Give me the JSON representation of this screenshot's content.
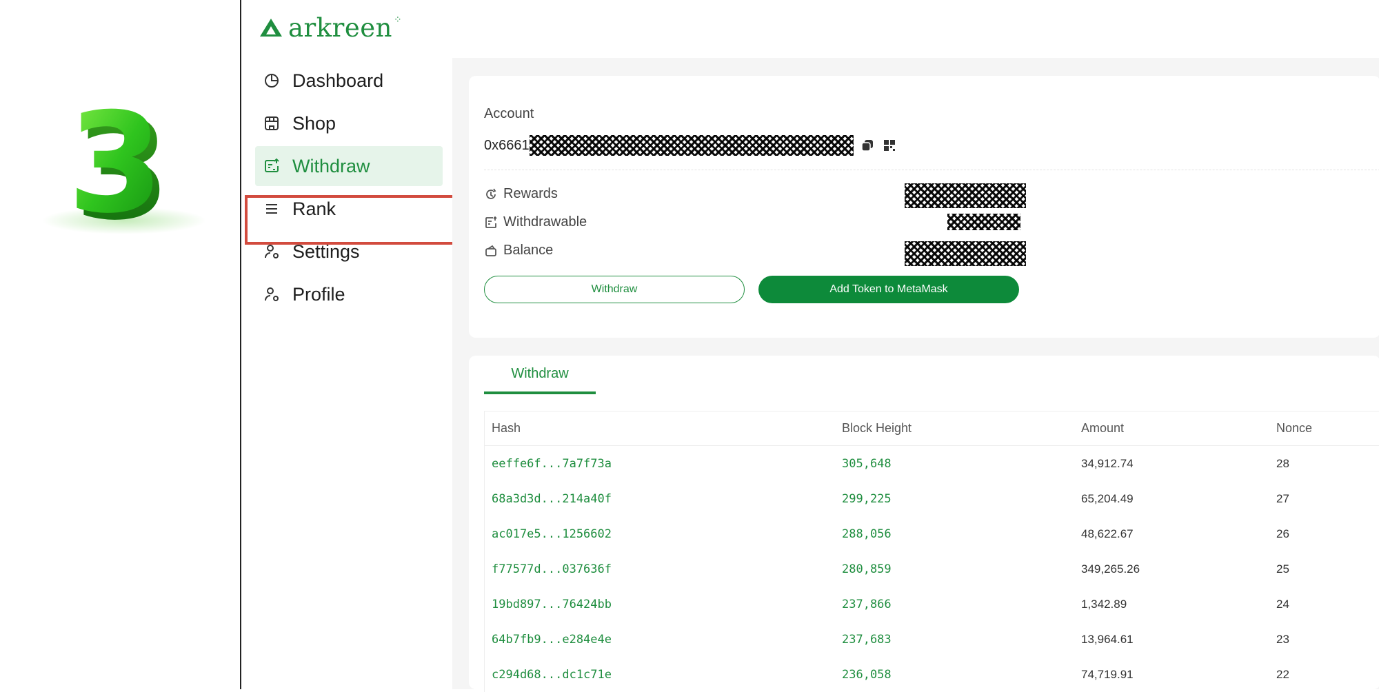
{
  "step_badge": {
    "number": "3"
  },
  "brand": {
    "name": "arkreen"
  },
  "sidebar": {
    "items": [
      {
        "label": "Dashboard",
        "icon": "pie-chart-icon"
      },
      {
        "label": "Shop",
        "icon": "store-icon"
      },
      {
        "label": "Withdraw",
        "icon": "withdraw-icon",
        "active": true
      },
      {
        "label": "Rank",
        "icon": "menu-lines-icon"
      },
      {
        "label": "Settings",
        "icon": "user-gear-icon"
      },
      {
        "label": "Profile",
        "icon": "user-gear-icon"
      }
    ]
  },
  "account": {
    "title": "Account",
    "address_prefix": "0x6661",
    "stats": [
      {
        "label": "Rewards",
        "icon": "rewards-icon"
      },
      {
        "label": "Withdrawable",
        "icon": "withdraw-icon"
      },
      {
        "label": "Balance",
        "icon": "wallet-icon"
      }
    ],
    "withdraw_button": "Withdraw",
    "metamask_button": "Add Token to MetaMask"
  },
  "history": {
    "tab": "Withdraw",
    "columns": [
      "Hash",
      "Block Height",
      "Amount",
      "Nonce"
    ],
    "rows": [
      {
        "hash": "eeffe6f...7a7f73a",
        "block": "305,648",
        "amount": "34,912.74",
        "nonce": "28"
      },
      {
        "hash": "68a3d3d...214a40f",
        "block": "299,225",
        "amount": "65,204.49",
        "nonce": "27"
      },
      {
        "hash": "ac017e5...1256602",
        "block": "288,056",
        "amount": "48,622.67",
        "nonce": "26"
      },
      {
        "hash": "f77577d...037636f",
        "block": "280,859",
        "amount": "349,265.26",
        "nonce": "25"
      },
      {
        "hash": "19bd897...76424bb",
        "block": "237,866",
        "amount": "1,342.89",
        "nonce": "24"
      },
      {
        "hash": "64b7fb9...e284e4e",
        "block": "237,683",
        "amount": "13,964.61",
        "nonce": "23"
      },
      {
        "hash": "c294d68...dc1c71e",
        "block": "236,058",
        "amount": "74,719.91",
        "nonce": "22"
      }
    ]
  },
  "colors": {
    "brand_green": "#1f8e3f",
    "highlight_red": "#d24b3e"
  }
}
